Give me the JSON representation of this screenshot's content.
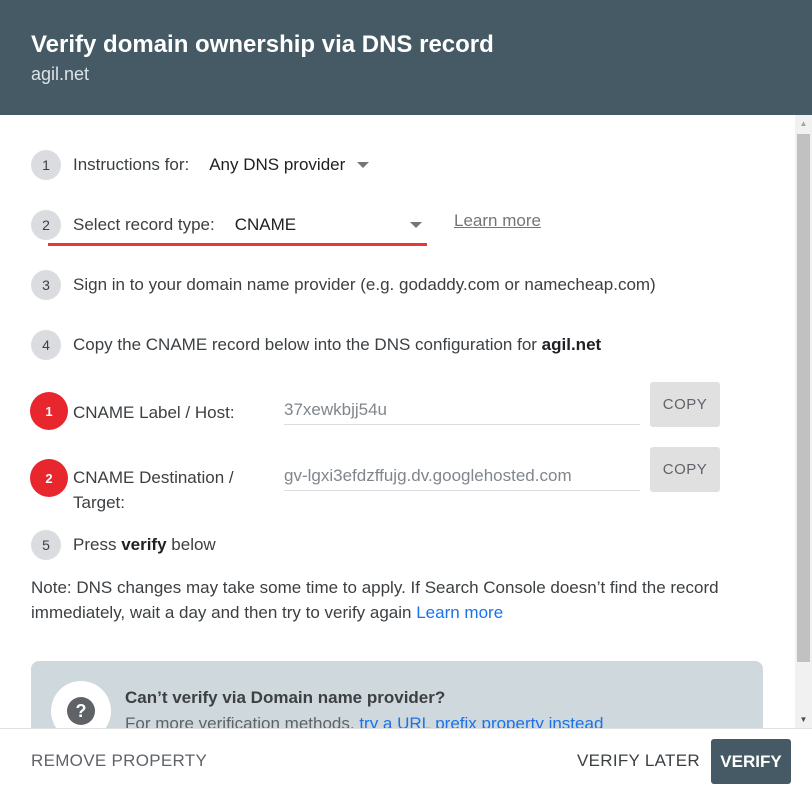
{
  "header": {
    "title": "Verify domain ownership via DNS record",
    "subtitle": "agil.net"
  },
  "steps": [
    {
      "number": "1",
      "label": "Instructions for:",
      "dropdown_value": "Any DNS provider"
    },
    {
      "number": "2",
      "label": "Select record type:",
      "dropdown_value": "CNAME",
      "link": "Learn more"
    },
    {
      "number": "3",
      "text": "Sign in to your domain name provider (e.g. godaddy.com or namecheap.com)"
    },
    {
      "number": "4",
      "text": "Copy the CNAME record below into the DNS configuration for ",
      "domain": "agil.net"
    },
    {
      "number": "5",
      "text_before": "Press ",
      "bold": "verify",
      "text_after": " below"
    }
  ],
  "records": [
    {
      "badge": "1",
      "label": "CNAME Label / Host:",
      "value": "37xewkbjj54u",
      "copy_label": "COPY"
    },
    {
      "badge": "2",
      "label": "CNAME Destination / Target:",
      "value": "gv-lgxi3efdzffujg.dv.googlehosted.com",
      "copy_label": "COPY"
    }
  ],
  "note": {
    "text": "Note: DNS changes may take some time to apply. If Search Console doesn’t find the record immediately, wait a day and then try to verify again ",
    "link": "Learn more"
  },
  "alternative": {
    "icon": "help-icon",
    "title": "Can’t verify via Domain name provider?",
    "text": "For more verification methods, ",
    "link": "try a URL prefix property instead"
  },
  "footer": {
    "remove_label": "REMOVE PROPERTY",
    "later_label": "VERIFY LATER",
    "verify_label": "VERIFY"
  },
  "colors": {
    "header_bg": "#455a64",
    "accent_red": "#e8262d",
    "link_blue": "#1a73e8"
  }
}
